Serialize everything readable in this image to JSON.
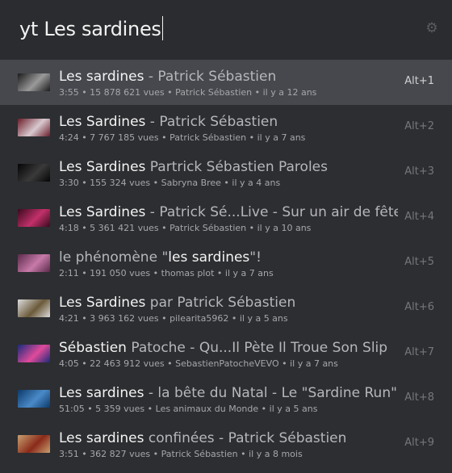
{
  "search": {
    "query": "yt Les sardines",
    "settings_icon": "gear-icon"
  },
  "results": [
    {
      "title_parts": [
        {
          "text": "Les sardines",
          "dim": false
        },
        {
          "text": " - Patrick Sébastien",
          "dim": true
        }
      ],
      "meta": "3:55 • 15 878 621 vues • Patrick Sébastien • il y a 12 ans",
      "shortcut": "Alt+1",
      "selected": true,
      "thumb_colors": [
        "#1b1b1b",
        "#9a9a9a"
      ]
    },
    {
      "title_parts": [
        {
          "text": "Les Sardines",
          "dim": false
        },
        {
          "text": " - Patrick Sébastien",
          "dim": true
        }
      ],
      "meta": "4:24 • 7 767 185 vues • Patrick Sébastien • il y a 7 ans",
      "shortcut": "Alt+2",
      "selected": false,
      "thumb_colors": [
        "#6b1d2a",
        "#d8c9cf"
      ]
    },
    {
      "title_parts": [
        {
          "text": "Les Sardines",
          "dim": false
        },
        {
          "text": " Partrick Sébastien Paroles",
          "dim": true
        }
      ],
      "meta": "3:30 • 155 324 vues • Sabryna Bree • il y a 4 ans",
      "shortcut": "Alt+3",
      "selected": false,
      "thumb_colors": [
        "#050505",
        "#3a3a3a"
      ]
    },
    {
      "title_parts": [
        {
          "text": "Les Sardines",
          "dim": false
        },
        {
          "text": " - Patrick Sé...Live - Sur un air de fête",
          "dim": true
        }
      ],
      "meta": "4:18 • 5 361 421 vues • Patrick Sébastien • il y a 10 ans",
      "shortcut": "Alt+4",
      "selected": false,
      "thumb_colors": [
        "#3a0a1e",
        "#c2306a"
      ]
    },
    {
      "title_parts": [
        {
          "text": "le phénomène \"",
          "dim": true
        },
        {
          "text": "les sardines",
          "dim": false
        },
        {
          "text": "\"!",
          "dim": true
        }
      ],
      "meta": "2:11 • 191 050 vues • thomas plot • il y a 7 ans",
      "shortcut": "Alt+5",
      "selected": false,
      "thumb_colors": [
        "#5a2a4a",
        "#c77aa8"
      ]
    },
    {
      "title_parts": [
        {
          "text": "Les Sardines",
          "dim": false
        },
        {
          "text": " par Patrick Sébastien",
          "dim": true
        }
      ],
      "meta": "4:21 • 3 963 162 vues • pilearita5962 • il y a 5 ans",
      "shortcut": "Alt+6",
      "selected": false,
      "thumb_colors": [
        "#dcdcdc",
        "#6b5a3a"
      ]
    },
    {
      "title_parts": [
        {
          "text": "Sébastien",
          "dim": false
        },
        {
          "text": " Patoche - Qu...Il Pète Il Troue Son Slip",
          "dim": true
        }
      ],
      "meta": "4:05 • 22 463 912 vues • SebastienPatocheVEVO • il y a 7 ans",
      "shortcut": "Alt+7",
      "selected": false,
      "thumb_colors": [
        "#1a2a7a",
        "#e04a9a"
      ]
    },
    {
      "title_parts": [
        {
          "text": "Les sardines",
          "dim": false
        },
        {
          "text": " - la bête du Natal - Le \"Sardine Run\"",
          "dim": true
        }
      ],
      "meta": "51:05 • 5 359 vues • Les animaux du Monde • il y a 5 ans",
      "shortcut": "Alt+8",
      "selected": false,
      "thumb_colors": [
        "#0d3a6a",
        "#4a8ac8"
      ]
    },
    {
      "title_parts": [
        {
          "text": "Les sardines",
          "dim": false
        },
        {
          "text": " confinées - Patrick Sébastien",
          "dim": true
        }
      ],
      "meta": "3:51 • 362 827 vues • Patrick Sébastien • il y a 8 mois",
      "shortcut": "Alt+9",
      "selected": false,
      "thumb_colors": [
        "#c8a070",
        "#8a2a1a"
      ]
    }
  ]
}
